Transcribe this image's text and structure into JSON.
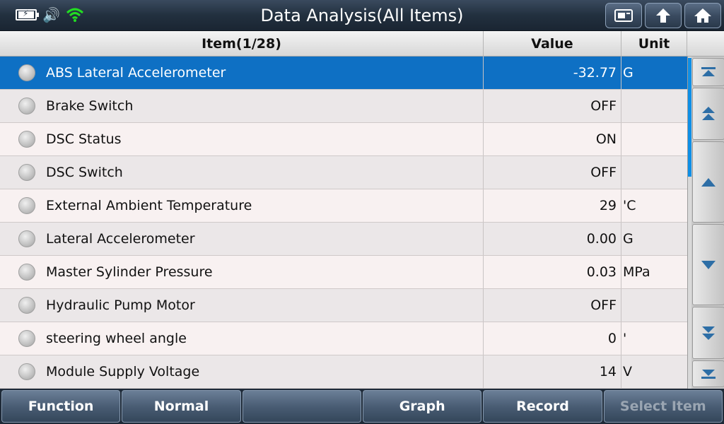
{
  "title": "Data Analysis(All Items)",
  "header": {
    "item": "Item(1/28)",
    "value": "Value",
    "unit": "Unit"
  },
  "rows": [
    {
      "label": "ABS Lateral Accelerometer",
      "value": "-32.77",
      "unit": "G",
      "selected": true
    },
    {
      "label": "Brake Switch",
      "value": "OFF",
      "unit": ""
    },
    {
      "label": "DSC Status",
      "value": "ON",
      "unit": ""
    },
    {
      "label": "DSC Switch",
      "value": "OFF",
      "unit": ""
    },
    {
      "label": "External Ambient Temperature",
      "value": "29",
      "unit": "'C"
    },
    {
      "label": "Lateral Accelerometer",
      "value": "0.00",
      "unit": "G"
    },
    {
      "label": "Master Sylinder Pressure",
      "value": "0.03",
      "unit": "MPa"
    },
    {
      "label": "Hydraulic Pump Motor",
      "value": "OFF",
      "unit": ""
    },
    {
      "label": "steering wheel angle",
      "value": "0",
      "unit": "'"
    },
    {
      "label": "Module Supply Voltage",
      "value": "14",
      "unit": "V"
    }
  ],
  "toolbar": {
    "function": "Function",
    "normal": "Normal",
    "blank": "",
    "graph": "Graph",
    "record": "Record",
    "select_item": "Select Item"
  },
  "colors": {
    "selected_row": "#0e70c4",
    "wifi": "#22dd22",
    "scroll_arrow": "#2d6ea6"
  }
}
